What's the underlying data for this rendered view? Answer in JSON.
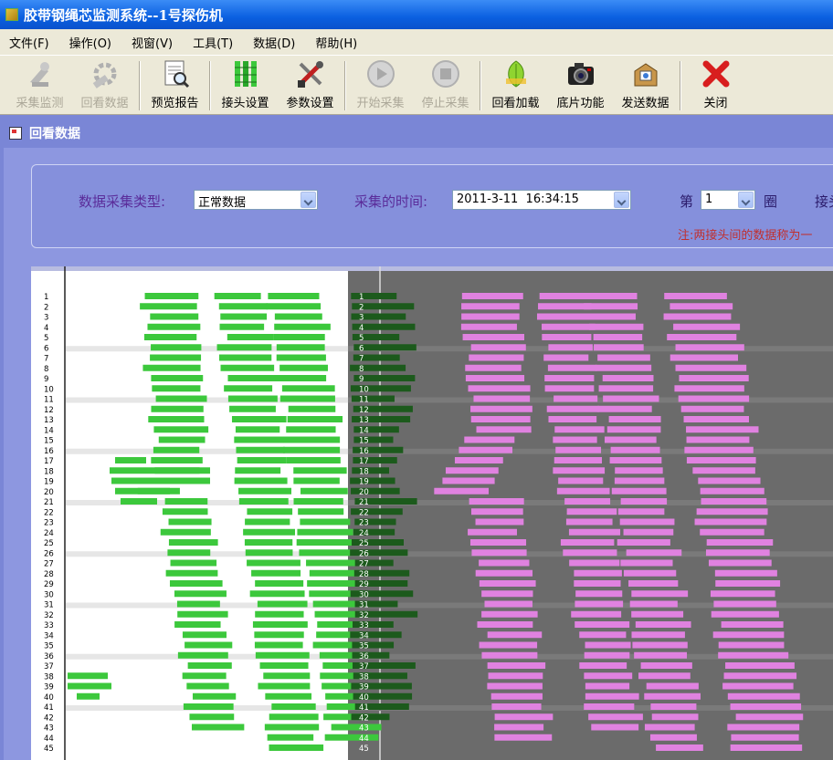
{
  "window": {
    "title": "胶带钢绳芯监测系统--1号探伤机"
  },
  "menu": [
    "文件(F)",
    "操作(O)",
    "视窗(V)",
    "工具(T)",
    "数据(D)",
    "帮助(H)"
  ],
  "toolbar": {
    "buttons": [
      {
        "label": "采集监测",
        "icon": "monitor-icon",
        "disabled": true
      },
      {
        "label": "回看数据",
        "icon": "playback-icon",
        "disabled": true
      },
      {
        "label": "预览报告",
        "icon": "report-preview-icon",
        "disabled": false
      },
      {
        "label": "接头设置",
        "icon": "joint-settings-icon",
        "disabled": false
      },
      {
        "label": "参数设置",
        "icon": "tools-icon",
        "disabled": false
      },
      {
        "label": "开始采集",
        "icon": "play-icon",
        "disabled": true
      },
      {
        "label": "停止采集",
        "icon": "stop-icon",
        "disabled": true
      },
      {
        "label": "回看加载",
        "icon": "leaf-load-icon",
        "disabled": false
      },
      {
        "label": "底片功能",
        "icon": "camera-icon",
        "disabled": false
      },
      {
        "label": "发送数据",
        "icon": "send-icon",
        "disabled": false
      },
      {
        "label": "关闭",
        "icon": "close-icon",
        "disabled": false
      }
    ]
  },
  "subwindow": {
    "title": "回看数据"
  },
  "filters": {
    "type_label": "数据采集类型:",
    "type_value": "正常数据",
    "time_label": "采集的时间:",
    "time_value": "2011-3-11  16:34:15",
    "round_prefix": "第",
    "round_value": "1",
    "round_suffix": "圈",
    "joint_label": "接头",
    "note": "注:两接头间的数据称为一"
  },
  "chart_data": {
    "type": "bar",
    "rows": [
      "1",
      "2",
      "3",
      "4",
      "5",
      "6",
      "7",
      "8",
      "9",
      "10",
      "11",
      "12",
      "13",
      "14",
      "15",
      "16",
      "17",
      "18",
      "19",
      "20",
      "21",
      "22",
      "23",
      "24",
      "25",
      "26",
      "27",
      "28",
      "29",
      "30",
      "31",
      "32",
      "33",
      "34",
      "35",
      "36",
      "37",
      "38",
      "39",
      "40",
      "41",
      "42",
      "43",
      "44",
      "45"
    ],
    "colors": {
      "left_panel_bg": "#ffffff",
      "right_panel_bg": "#6b6b6b",
      "left_bar": "#3cc83c",
      "right_bar": "#e082e0",
      "overlap_bar": "#1c5a1c",
      "stripe_left": "#e6e6e6",
      "stripe_right": "#7a7a7a"
    }
  }
}
